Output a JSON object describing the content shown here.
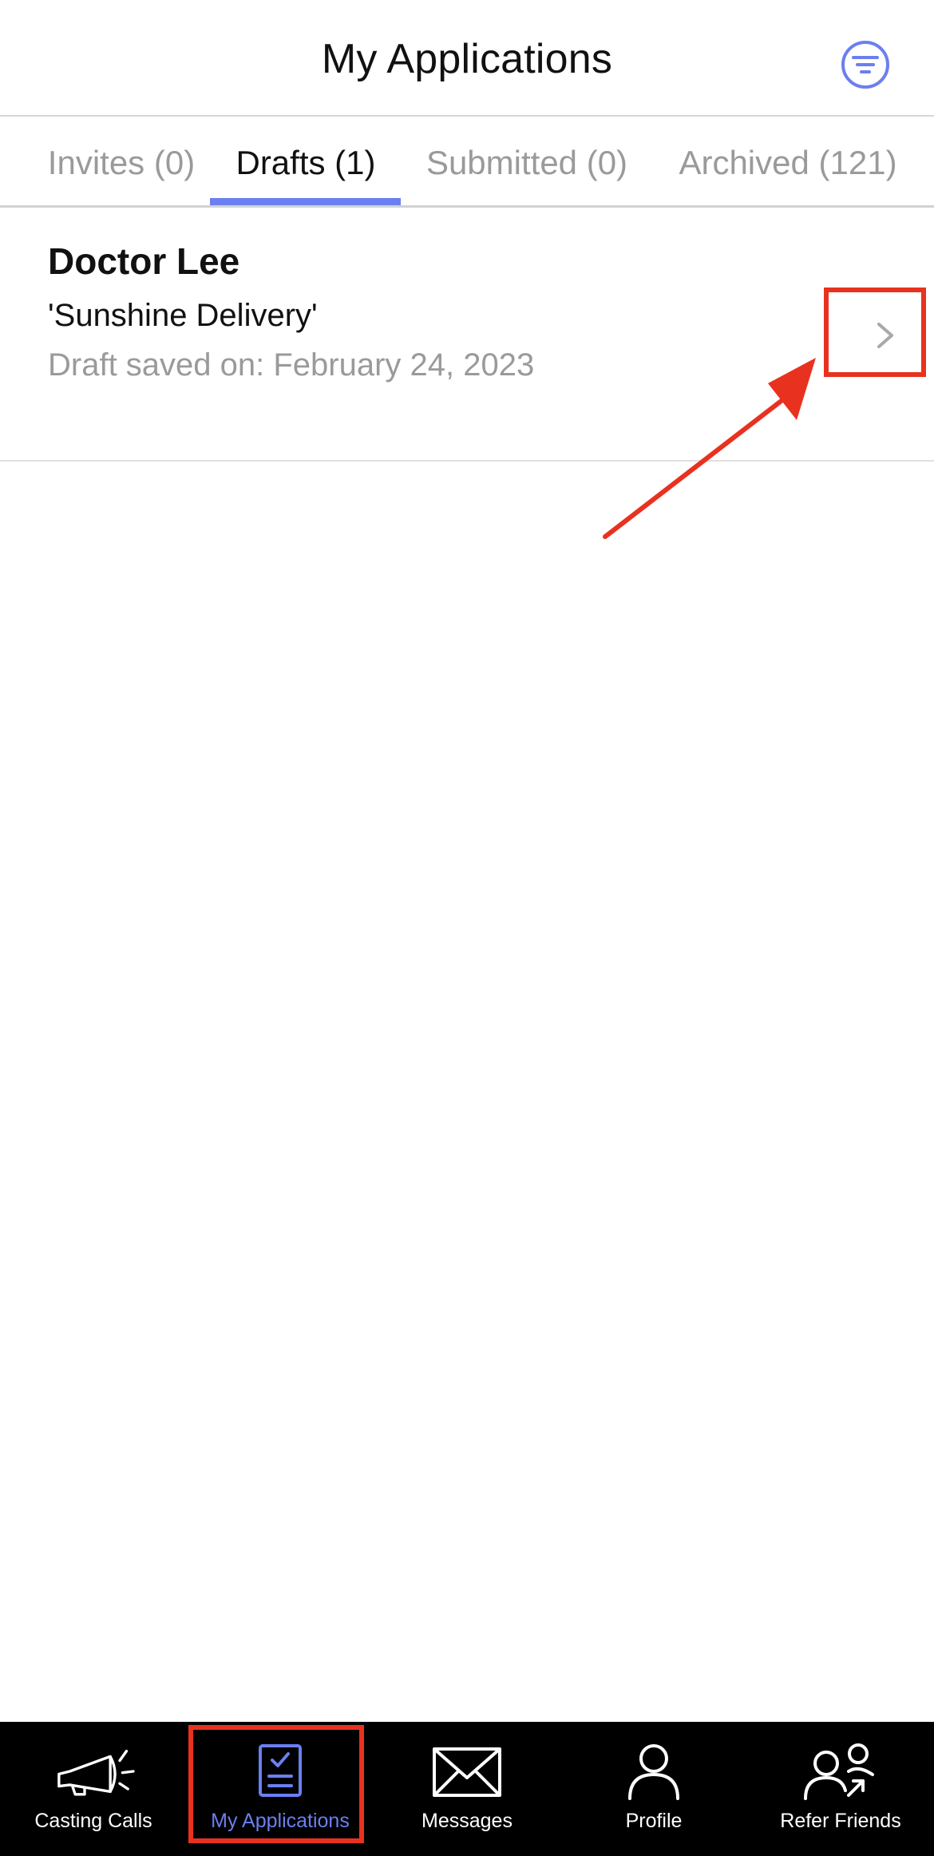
{
  "header": {
    "title": "My Applications",
    "filter_icon": "filter-icon"
  },
  "tabs": [
    {
      "label": "Invites (0)",
      "active": false
    },
    {
      "label": "Drafts (1)",
      "active": true
    },
    {
      "label": "Submitted (0)",
      "active": false
    },
    {
      "label": "Archived (121)",
      "active": false
    }
  ],
  "drafts": [
    {
      "title": "Doctor Lee",
      "project": "'Sunshine Delivery'",
      "saved": "Draft saved on: February 24, 2023"
    }
  ],
  "bottom_nav": [
    {
      "label": "Casting Calls",
      "icon": "megaphone-icon",
      "active": false
    },
    {
      "label": "My Applications",
      "icon": "clipboard-check-icon",
      "active": true
    },
    {
      "label": "Messages",
      "icon": "envelope-icon",
      "active": false
    },
    {
      "label": "Profile",
      "icon": "person-icon",
      "active": false
    },
    {
      "label": "Refer Friends",
      "icon": "people-share-icon",
      "active": false
    }
  ],
  "colors": {
    "accent": "#6b7ff0",
    "annotation": "#e8321f",
    "nav_background": "#000000",
    "muted_text": "#9a9a9a"
  }
}
